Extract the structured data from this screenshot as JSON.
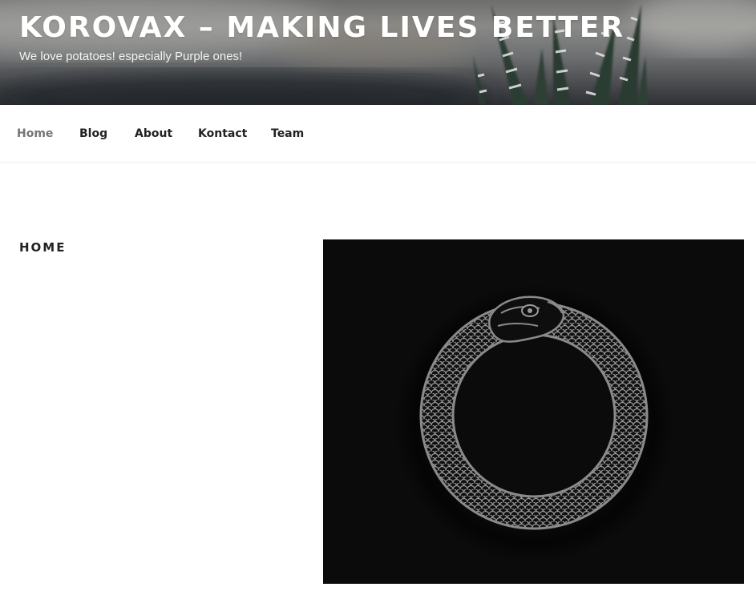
{
  "header": {
    "site_title": "KOROVAX – MAKING LIVES BETTER",
    "tagline": "We love potatoes! especially Purple ones!",
    "background_image": "blurred-plant-photo"
  },
  "nav": {
    "items": [
      {
        "label": "Home",
        "current": true
      },
      {
        "label": "Blog",
        "current": false
      },
      {
        "label": "About",
        "current": false
      },
      {
        "label": "Kontact",
        "current": false
      },
      {
        "label": "Team",
        "current": false
      }
    ],
    "current_color": "#767676",
    "link_color": "#222222"
  },
  "main": {
    "page_title": "HOME",
    "featured_image": {
      "subject": "ouroboros-snake-image",
      "background_color": "#0b0b0b"
    }
  }
}
